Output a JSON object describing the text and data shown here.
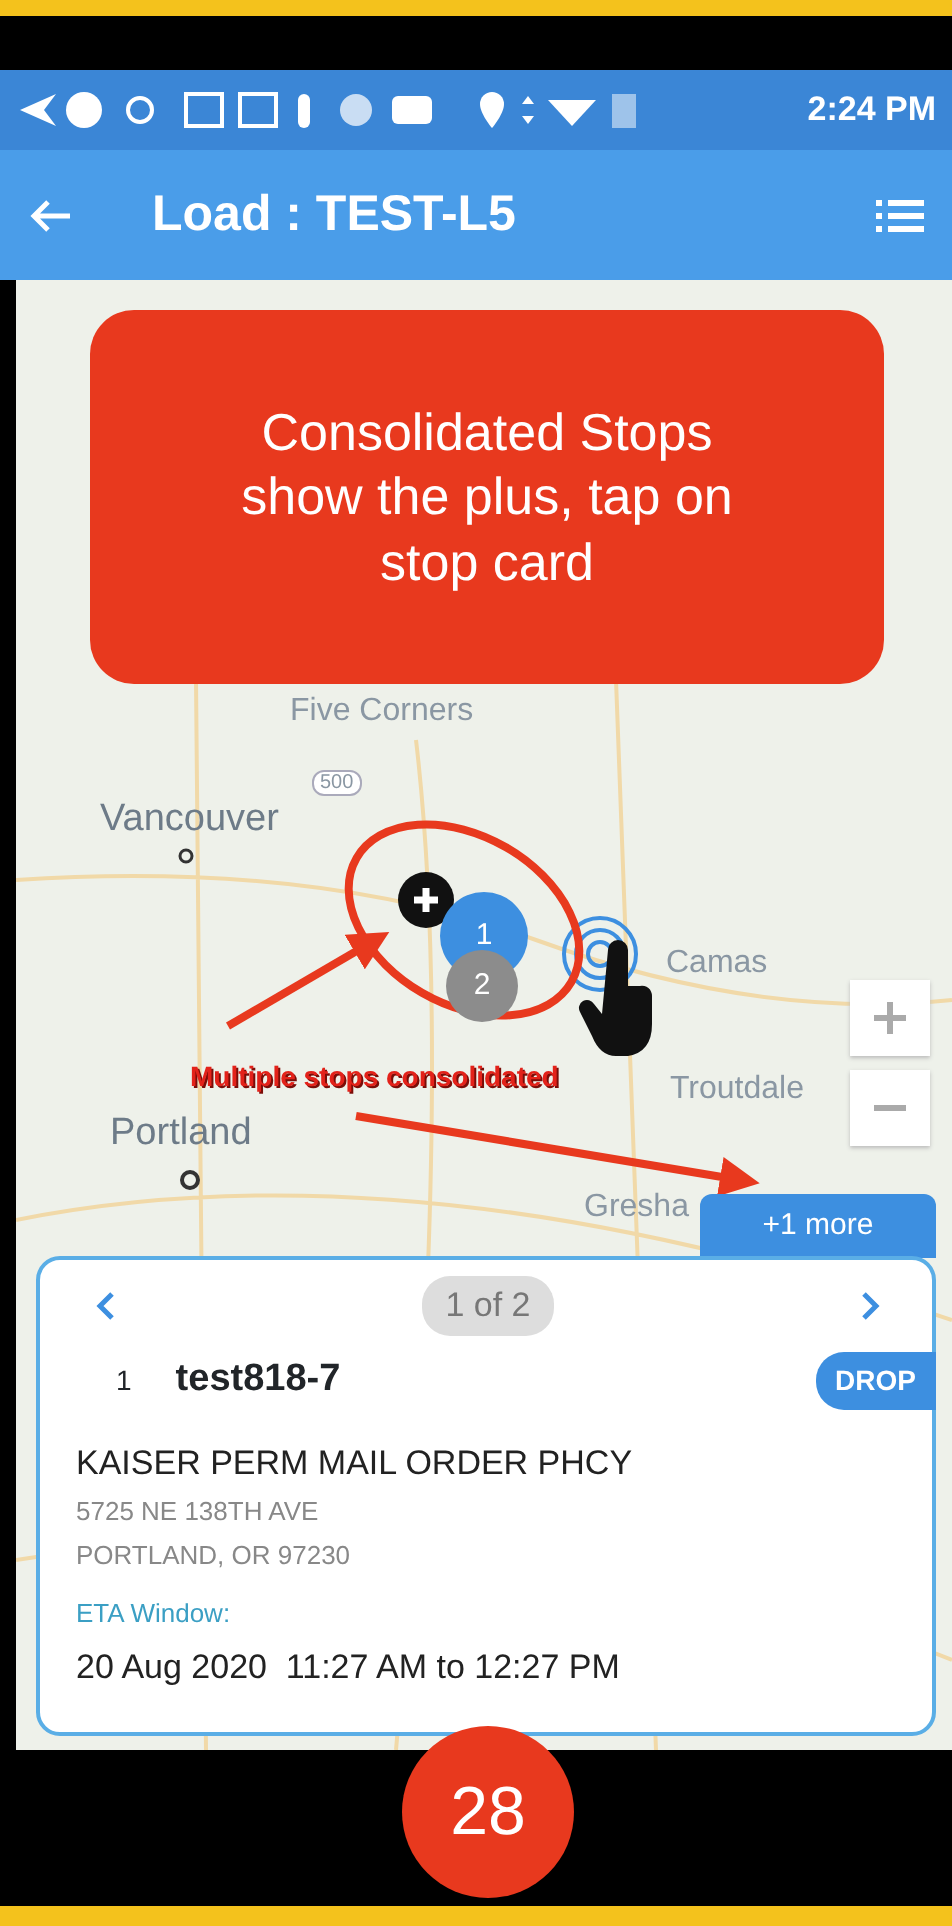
{
  "status_bar": {
    "time": "2:24 PM"
  },
  "app_bar": {
    "title": "Load : TEST-L5"
  },
  "callout": {
    "text": "Consolidated Stops show the plus, tap on stop card"
  },
  "map": {
    "labels": [
      {
        "text": "Five Corners",
        "kind": "area"
      },
      {
        "text": "500",
        "kind": "route"
      },
      {
        "text": "Vancouver",
        "kind": "city"
      },
      {
        "text": "Camas",
        "kind": "area"
      },
      {
        "text": "Troutdale",
        "kind": "area"
      },
      {
        "text": "Portland",
        "kind": "city"
      },
      {
        "text": "Gresha",
        "kind": "area"
      }
    ],
    "markers": [
      {
        "number": "1",
        "color": "#3d8fe0"
      },
      {
        "number": "2",
        "color": "#8c8c8c"
      }
    ],
    "annotation": "Multiple stops consolidated",
    "more_tab": "+1 more"
  },
  "stop_card": {
    "pager": "1 of 2",
    "sequence": "1",
    "stop_id": "test818-7",
    "type_badge": "DROP",
    "name": "KAISER PERM MAIL ORDER PHCY",
    "address_lines": [
      "5725 NE 138TH AVE",
      "PORTLAND, OR 97230"
    ],
    "eta_label": "ETA Window:",
    "eta": "20 Aug 2020  11:27 AM to 12:27 PM"
  },
  "page_number": "28"
}
